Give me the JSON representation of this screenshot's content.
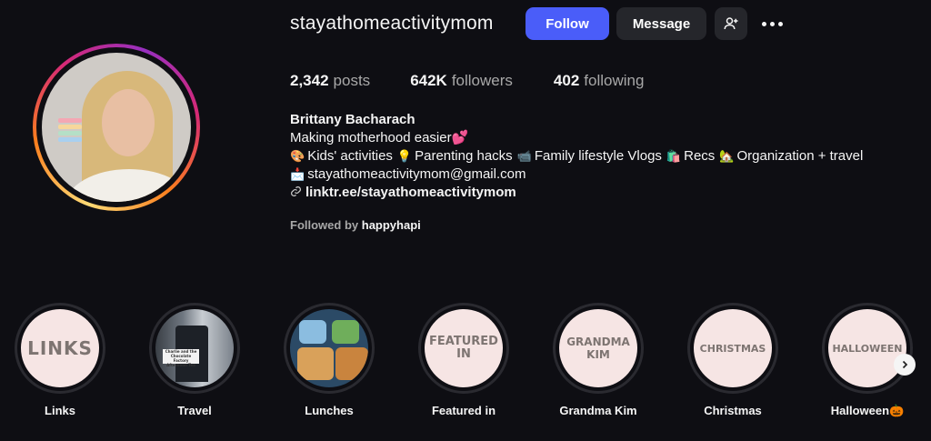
{
  "profile": {
    "username": "stayathomeactivitymom",
    "follow_label": "Follow",
    "message_label": "Message",
    "posts_count": "2,342",
    "posts_label": "posts",
    "followers_count": "642K",
    "followers_label": "followers",
    "following_count": "402",
    "following_label": "following",
    "full_name": "Brittany Bacharach",
    "bio_line1": "Making motherhood easier",
    "bio_line1_emoji": "💕",
    "bio_line2": [
      {
        "emoji": "🎨",
        "text": "Kids' activities"
      },
      {
        "emoji": "💡",
        "text": "Parenting hacks"
      },
      {
        "emoji": "📹",
        "text": "Family lifestyle Vlogs"
      },
      {
        "emoji": "🛍️",
        "text": "Recs"
      },
      {
        "emoji": "🏡",
        "text": "Organization + travel"
      }
    ],
    "email_emoji": "📩",
    "email": "stayathomeactivitymom@gmail.com",
    "link_icon": "link-icon",
    "link": "linktr.ee/stayathomeactivitymom",
    "followed_by_prefix": "Followed by",
    "followed_by_user": "happyhapi"
  },
  "highlights": [
    {
      "label": "Links",
      "cover_text": "LINKS"
    },
    {
      "label": "Travel",
      "cover_text": "Charlie and the Chocolate Factory Afternoon Tea"
    },
    {
      "label": "Lunches",
      "cover_text": ""
    },
    {
      "label": "Featured in",
      "cover_text": "FEATURED IN"
    },
    {
      "label": "Grandma Kim",
      "cover_text": "GRANDMA KIM"
    },
    {
      "label": "Christmas",
      "cover_text": "CHRISTMAS"
    },
    {
      "label": "Halloween",
      "cover_text": "HALLOWEEN",
      "label_emoji": "🎃"
    }
  ],
  "colors": {
    "background": "#0e0e13",
    "follow_button": "#4a5df9",
    "secondary_button": "#25262b",
    "highlight_cover": "#f6e5e4",
    "highlight_text": "#7d7471"
  },
  "icons": {
    "add_user": "add-user-icon",
    "more": "more-options-icon",
    "next": "chevron-right-icon"
  }
}
